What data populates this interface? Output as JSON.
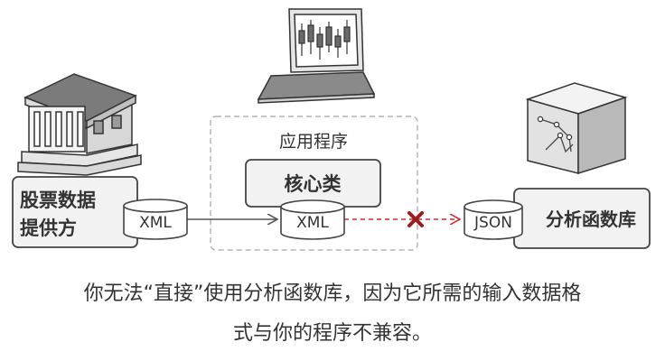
{
  "diagram": {
    "stock_provider": {
      "line1": "股票数据",
      "line2": "提供方"
    },
    "xml_source": "XML",
    "app_group_label": "应用程序",
    "core_class": "核心类",
    "xml_target": "XML",
    "json_target": "JSON",
    "analytics_library": "分析函数库",
    "incompatible_mark": "×"
  },
  "caption": {
    "line1": "你无法“直接”使用分析函数库，因为它所需的输入数据格",
    "line2": "式与你的程序不兼容。"
  },
  "colors": {
    "line": "#444444",
    "fill": "#f2f2f2",
    "dashed_group": "#b5b5b5",
    "broken_arrow": "#d02a2a"
  }
}
